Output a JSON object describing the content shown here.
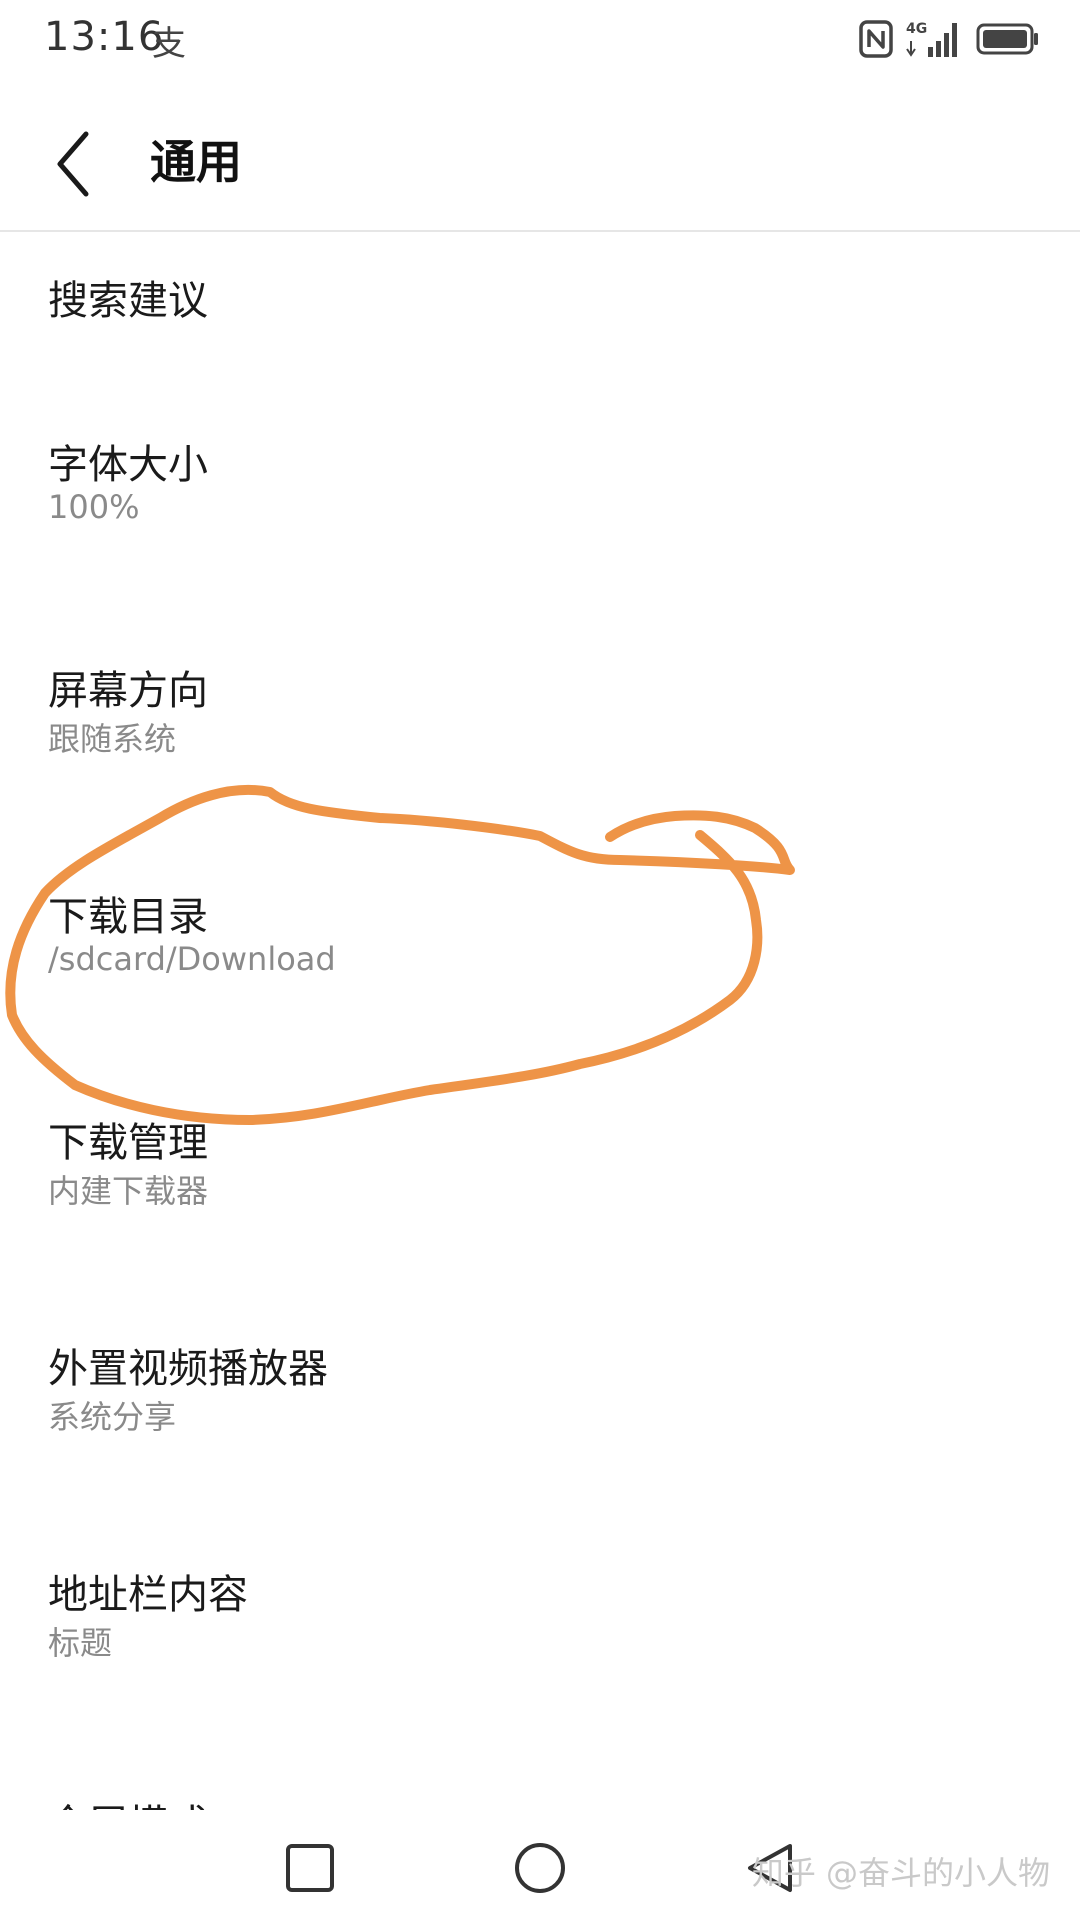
{
  "status_bar": {
    "time": "13:16",
    "alipay_glyph": "支",
    "network_label": "4G",
    "icons": [
      "alipay-icon",
      "nfc-icon",
      "signal-icon",
      "battery-icon"
    ]
  },
  "header": {
    "title": "通用",
    "back_icon": "chevron-left-icon"
  },
  "settings": {
    "items": [
      {
        "title": "搜索建议",
        "value": ""
      },
      {
        "title": "字体大小",
        "value": "100%"
      },
      {
        "title": "屏幕方向",
        "value": "跟随系统"
      },
      {
        "title": "下载目录",
        "value": "/sdcard/Download"
      },
      {
        "title": "下载管理",
        "value": "内建下载器"
      },
      {
        "title": "外置视频播放器",
        "value": "系统分享"
      },
      {
        "title": "地址栏内容",
        "value": "标题"
      }
    ],
    "partial_item": "全屏模式"
  },
  "annotation": {
    "color": "#EE9447",
    "target": "下载目录"
  },
  "navigation": {
    "icons": [
      "square-recent-icon",
      "circle-home-icon",
      "triangle-back-icon"
    ]
  },
  "watermark": "知乎 @奋斗的小人物"
}
